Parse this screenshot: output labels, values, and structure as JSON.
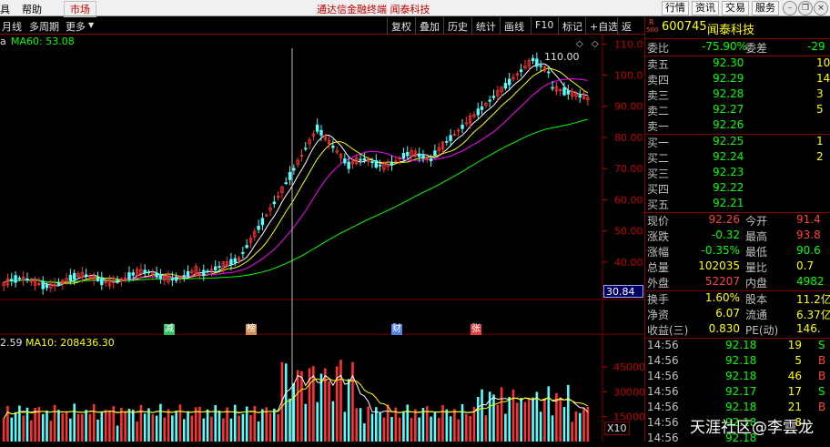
{
  "menu": {
    "item1": "具",
    "item2": "帮助",
    "item3": "市场",
    "title": "通达信金融终端  闻泰科技",
    "btn_quote": "行情",
    "btn_info": "资讯",
    "btn_trade": "交易",
    "btn_service": "服务"
  },
  "toolbar": {
    "period": "月线",
    "multi": "多周期",
    "more": "更多",
    "buttons": [
      "复权",
      "叠加",
      "历史",
      "统计",
      "画线",
      "F10",
      "标记",
      "+自选",
      "返回"
    ]
  },
  "ma_label": "MA60: 53.08",
  "vol_label": "2.59",
  "vol_ma_label": "MA10: 208436.30",
  "last_price_tag": "30.84",
  "peak_label": "110.00",
  "x10": "X10",
  "event_markers": [
    {
      "label": "减",
      "color": "#30c060"
    },
    {
      "label": "榜",
      "color": "#d09050"
    },
    {
      "label": "财",
      "color": "#5080e0"
    },
    {
      "label": "张",
      "color": "#e04040"
    }
  ],
  "chart_data": {
    "type": "candlestick",
    "price_axis": [
      110,
      100,
      90,
      80,
      70,
      60,
      50,
      40,
      30
    ],
    "price_axis_labels": [
      "110.0",
      "100.0",
      "90.00",
      "80.00",
      "70.00",
      "60.00",
      "50.00",
      "40.00",
      "30.00"
    ],
    "volume_axis": [
      45000,
      30000,
      15000
    ],
    "ylim": [
      28,
      113
    ],
    "colors": {
      "up": "#ff3232",
      "down": "#54ffff",
      "ma5": "#ffffff",
      "ma10": "#ffff00",
      "ma20": "#ff00ff",
      "ma60": "#00ff00"
    }
  },
  "stock": {
    "r_top": "R",
    "r_bottom": "500",
    "code": "600745",
    "name": "闻泰科技"
  },
  "quote": {
    "weibi_label": "委比",
    "weibi": "-75.90%",
    "weicha_label": "委差",
    "weicha": "-29",
    "asks": [
      {
        "label": "卖五",
        "price": "92.30",
        "vol": "10"
      },
      {
        "label": "卖四",
        "price": "92.29",
        "vol": "14"
      },
      {
        "label": "卖三",
        "price": "92.28",
        "vol": "3"
      },
      {
        "label": "卖二",
        "price": "92.27",
        "vol": "5"
      },
      {
        "label": "卖一",
        "price": "92.26",
        "vol": ""
      }
    ],
    "bids": [
      {
        "label": "买一",
        "price": "92.25",
        "vol": "1"
      },
      {
        "label": "买二",
        "price": "92.24",
        "vol": "2"
      },
      {
        "label": "买三",
        "price": "92.23",
        "vol": ""
      },
      {
        "label": "买四",
        "price": "92.22",
        "vol": ""
      },
      {
        "label": "买五",
        "price": "92.21",
        "vol": ""
      }
    ],
    "stats": [
      {
        "l1": "现价",
        "v1": "92.26",
        "c1": "#ff4040",
        "l2": "今开",
        "v2": "91.4",
        "c2": "#ff4040"
      },
      {
        "l1": "涨跌",
        "v1": "-0.32",
        "c1": "#00ff00",
        "l2": "最高",
        "v2": "93.8",
        "c2": "#ff4040"
      },
      {
        "l1": "涨幅",
        "v1": "-0.35%",
        "c1": "#00ff00",
        "l2": "最低",
        "v2": "90.6",
        "c2": "#00ff00"
      },
      {
        "l1": "总量",
        "v1": "102035",
        "c1": "#ffff00",
        "l2": "量比",
        "v2": "0.7",
        "c2": "#ffff00"
      },
      {
        "l1": "外盘",
        "v1": "52207",
        "c1": "#ff4040",
        "l2": "内盘",
        "v2": "4982",
        "c2": "#00ff00"
      }
    ],
    "stats2": [
      {
        "l1": "换手",
        "v1": "1.60%",
        "c1": "#ffff00",
        "l2": "股本",
        "v2": "11.2亿",
        "c2": "#ffff00"
      },
      {
        "l1": "净资",
        "v1": "6.07",
        "c1": "#ffff00",
        "l2": "流通",
        "v2": "6.37亿",
        "c2": "#ffff00"
      },
      {
        "l1": "收益(三)",
        "v1": "0.830",
        "c1": "#ffff00",
        "l2": "PE(动)",
        "v2": "146.",
        "c2": "#ffff00"
      }
    ],
    "ticks": [
      {
        "time": "14:56",
        "price": "92.18",
        "vol": "19",
        "flag": "S",
        "fc": "#00ff00"
      },
      {
        "time": "14:56",
        "price": "92.18",
        "vol": "5",
        "flag": "B",
        "fc": "#ff4040"
      },
      {
        "time": "14:56",
        "price": "92.18",
        "vol": "46",
        "flag": "B",
        "fc": "#ff4040"
      },
      {
        "time": "14:56",
        "price": "92.17",
        "vol": "17",
        "flag": "S",
        "fc": "#00ff00"
      },
      {
        "time": "14:56",
        "price": "92.18",
        "vol": "21",
        "flag": "B",
        "fc": "#ff4040"
      },
      {
        "time": "14:56",
        "price": "92.18",
        "vol": "8",
        "flag": "",
        "fc": "#ff4040"
      },
      {
        "time": "14:56",
        "price": "92.18",
        "vol": "",
        "flag": "",
        "fc": "#ff4040"
      }
    ]
  },
  "watermark": "天涯社区@李雲龙"
}
